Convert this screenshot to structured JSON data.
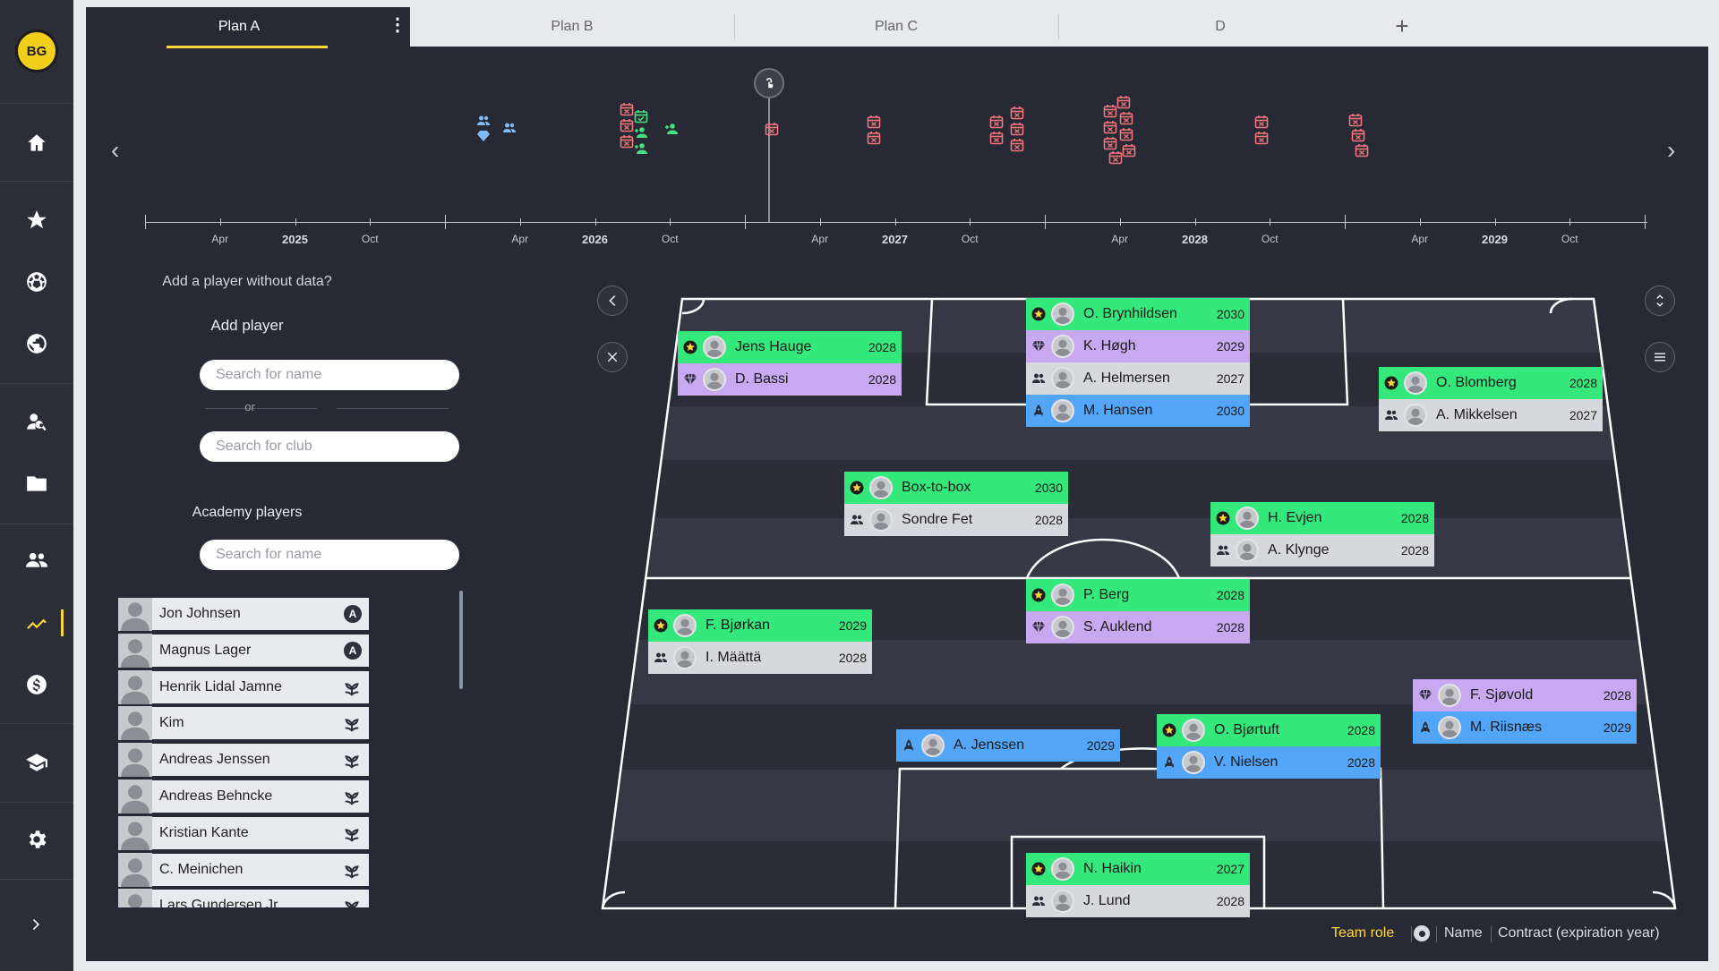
{
  "app": {
    "logo_text": "BG"
  },
  "sidebar": {
    "items": [
      {
        "icon": "home-icon"
      },
      {
        "icon": "star-icon"
      },
      {
        "icon": "football-icon"
      },
      {
        "icon": "globe-icon"
      },
      {
        "icon": "scout-search-icon"
      },
      {
        "icon": "folder-icon"
      },
      {
        "icon": "team-icon"
      },
      {
        "icon": "trend-chart-icon"
      },
      {
        "icon": "dollar-icon"
      },
      {
        "icon": "graduation-cap-icon"
      },
      {
        "icon": "gear-icon"
      },
      {
        "icon": "chevron-right-icon"
      }
    ],
    "active_item": "trend-chart-icon",
    "accent": "#ffd83a"
  },
  "tabs": [
    {
      "label": "Plan A",
      "active": true
    },
    {
      "label": "Plan B",
      "active": false
    },
    {
      "label": "Plan C",
      "active": false
    },
    {
      "label": "D",
      "active": false
    }
  ],
  "timeline": {
    "years": [
      "2025",
      "2026",
      "2027",
      "2028",
      "2029"
    ],
    "months": [
      "Apr",
      "Oct"
    ]
  },
  "left_panel": {
    "add_question": "Add a player without data?",
    "add_title": "Add player",
    "search_name_placeholder": "Search for name",
    "or_text": "or",
    "search_club_placeholder": "Search for club",
    "academy_title": "Academy players",
    "academy_search_placeholder": "Search for name",
    "academy_players": [
      {
        "name": "Jon Johnsen",
        "badge": "A"
      },
      {
        "name": "Magnus Lager",
        "badge": "A"
      },
      {
        "name": "Henrik Lidal Jamne",
        "badge": "sprout"
      },
      {
        "name": "Kim",
        "badge": "sprout"
      },
      {
        "name": "Andreas Jenssen",
        "badge": "sprout"
      },
      {
        "name": "Andreas Behncke",
        "badge": "sprout"
      },
      {
        "name": "Kristian Kante",
        "badge": "sprout"
      },
      {
        "name": "C. Meinichen",
        "badge": "sprout"
      },
      {
        "name": "Lars Gundersen Jr",
        "badge": "sprout"
      }
    ]
  },
  "pitch": {
    "cards": [
      {
        "id": "lw",
        "rows": [
          {
            "role": "star",
            "name": "Jens Hauge",
            "year": "2028"
          },
          {
            "role": "diamond",
            "name": "D. Bassi",
            "year": "2028"
          }
        ]
      },
      {
        "id": "st",
        "rows": [
          {
            "role": "star",
            "name": "O. Brynhildsen",
            "year": "2030"
          },
          {
            "role": "diamond",
            "name": "K. Høgh",
            "year": "2029"
          },
          {
            "role": "team",
            "name": "A. Helmersen",
            "year": "2027"
          },
          {
            "role": "rocket",
            "name": "M. Hansen",
            "year": "2030"
          }
        ]
      },
      {
        "id": "rw",
        "rows": [
          {
            "role": "star",
            "name": "O. Blomberg",
            "year": "2028"
          },
          {
            "role": "team",
            "name": "A. Mikkelsen",
            "year": "2027"
          }
        ]
      },
      {
        "id": "lcm",
        "rows": [
          {
            "role": "star",
            "name": "Box-to-box",
            "year": "2030"
          },
          {
            "role": "team",
            "name": "Sondre Fet",
            "year": "2028"
          }
        ]
      },
      {
        "id": "rcm",
        "rows": [
          {
            "role": "star",
            "name": "H. Evjen",
            "year": "2028"
          },
          {
            "role": "team",
            "name": "A. Klynge",
            "year": "2028"
          }
        ]
      },
      {
        "id": "dm",
        "rows": [
          {
            "role": "star",
            "name": "P. Berg",
            "year": "2028"
          },
          {
            "role": "diamond",
            "name": "S. Auklend",
            "year": "2028"
          }
        ]
      },
      {
        "id": "lb",
        "rows": [
          {
            "role": "star",
            "name": "F. Bjørkan",
            "year": "2029"
          },
          {
            "role": "team",
            "name": "I. Määttä",
            "year": "2028"
          }
        ]
      },
      {
        "id": "rb",
        "rows": [
          {
            "role": "diamond",
            "name": "F. Sjøvold",
            "year": "2028"
          },
          {
            "role": "rocket",
            "name": "M. Riisnæs",
            "year": "2029"
          }
        ]
      },
      {
        "id": "lcb",
        "rows": [
          {
            "role": "rocket",
            "name": "A. Jenssen",
            "year": "2029"
          }
        ]
      },
      {
        "id": "rcb",
        "rows": [
          {
            "role": "star",
            "name": "O. Bjørtuft",
            "year": "2028"
          },
          {
            "role": "rocket",
            "name": "V. Nielsen",
            "year": "2028"
          }
        ]
      },
      {
        "id": "gk",
        "rows": [
          {
            "role": "star",
            "name": "N. Haikin",
            "year": "2027"
          },
          {
            "role": "team",
            "name": "J. Lund",
            "year": "2028"
          }
        ]
      }
    ],
    "role_colors": {
      "star": "#35e87c",
      "diamond": "#c8a8f0",
      "team": "#d7d8dc",
      "rocket": "#52a5f7"
    }
  },
  "legend": {
    "team_role": "Team role",
    "name": "Name",
    "contract": "Contract (expiration year)"
  }
}
